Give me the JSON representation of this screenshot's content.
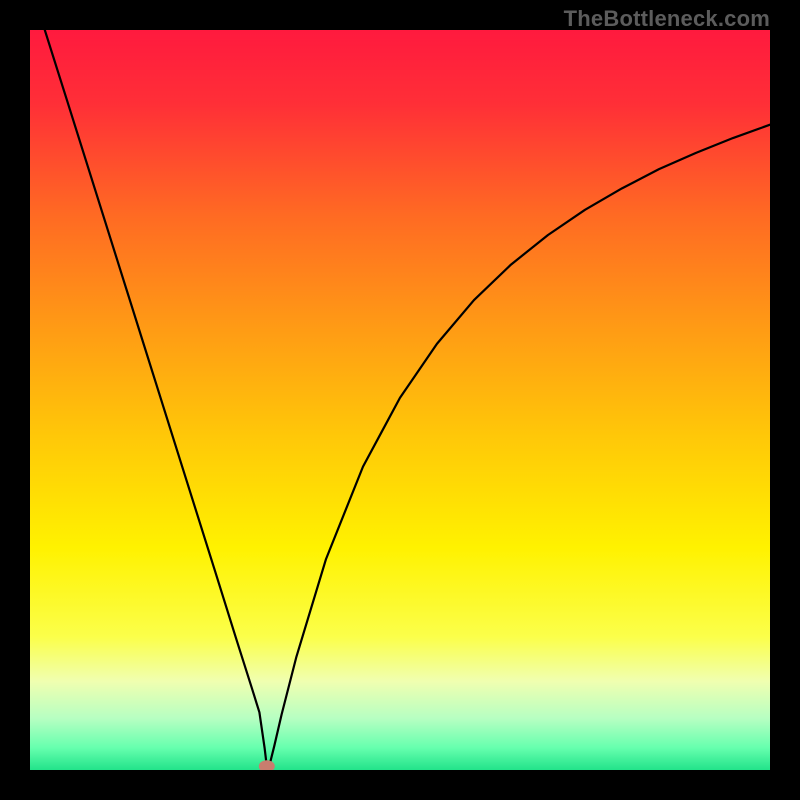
{
  "watermark": "TheBottleneck.com",
  "chart_data": {
    "type": "line",
    "title": "",
    "xlabel": "",
    "ylabel": "",
    "xlim": [
      0,
      100
    ],
    "ylim": [
      0,
      100
    ],
    "grid": false,
    "legend": false,
    "background": {
      "type": "vertical-gradient",
      "stops": [
        {
          "pos": 0.0,
          "color": "#ff1a3e"
        },
        {
          "pos": 0.1,
          "color": "#ff2f37"
        },
        {
          "pos": 0.25,
          "color": "#ff6a23"
        },
        {
          "pos": 0.4,
          "color": "#ff9a15"
        },
        {
          "pos": 0.55,
          "color": "#ffc808"
        },
        {
          "pos": 0.7,
          "color": "#fff200"
        },
        {
          "pos": 0.82,
          "color": "#fbff4a"
        },
        {
          "pos": 0.88,
          "color": "#f0ffb0"
        },
        {
          "pos": 0.93,
          "color": "#b7ffc2"
        },
        {
          "pos": 0.97,
          "color": "#66ffae"
        },
        {
          "pos": 1.0,
          "color": "#22e38a"
        }
      ]
    },
    "series": [
      {
        "name": "bottleneck-curve",
        "color": "#000000",
        "width": 2.2,
        "x": [
          2,
          5,
          10,
          15,
          20,
          25,
          28,
          30,
          31,
          31.7,
          32,
          32.5,
          33,
          34,
          36,
          40,
          45,
          50,
          55,
          60,
          65,
          70,
          75,
          80,
          85,
          90,
          95,
          100
        ],
        "y": [
          100,
          90.5,
          74.6,
          58.7,
          42.8,
          26.9,
          17.3,
          11.0,
          7.8,
          3.0,
          0.5,
          1.2,
          3.2,
          7.5,
          15.3,
          28.5,
          41.0,
          50.3,
          57.6,
          63.5,
          68.3,
          72.3,
          75.7,
          78.6,
          81.2,
          83.4,
          85.4,
          87.2
        ]
      }
    ],
    "marker": {
      "name": "optimal-point",
      "x": 32,
      "y": 0.5,
      "rx": 8,
      "ry": 6,
      "color": "#c97d6e"
    }
  }
}
